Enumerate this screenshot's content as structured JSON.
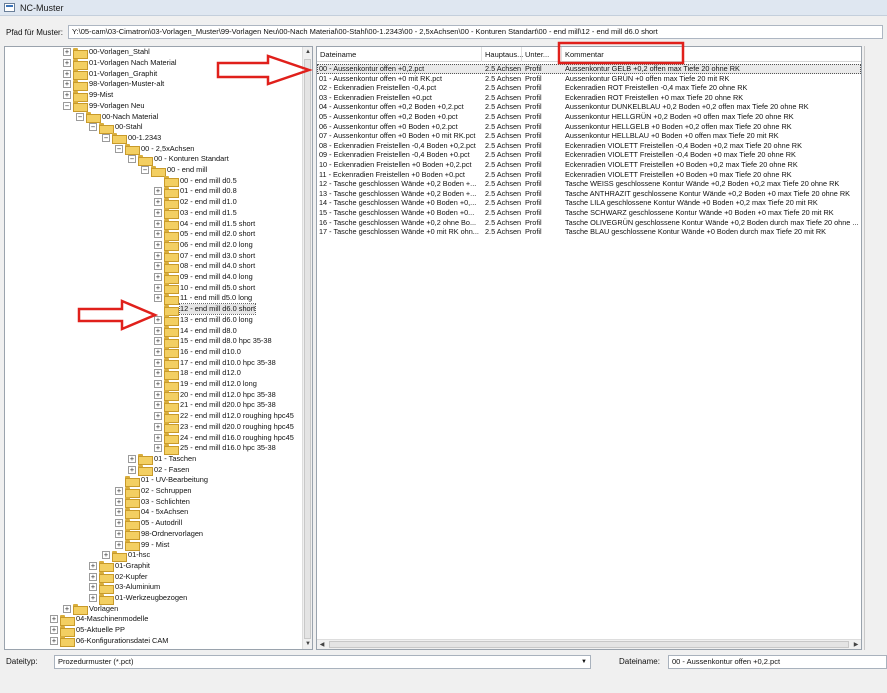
{
  "window": {
    "title": "NC-Muster"
  },
  "path": {
    "label": "Pfad für Muster:",
    "value": "Y:\\05-cam\\03-Cimatron\\03-Vorlagen_Muster\\99-Vorlagen Neu\\00-Nach Material\\00-Stahl\\00-1.2343\\00 - 2,5xAchsen\\00 - Konturen Standart\\00 - end mill\\12 - end mill d6.0 short"
  },
  "tree": {
    "items": [
      {
        "label": "00-Vorlagen_Stahl",
        "expander": "+"
      },
      {
        "label": "01-Vorlagen Nach Material",
        "expander": "+"
      },
      {
        "label": "01-Vorlagen_Graphit",
        "expander": "+"
      },
      {
        "label": "98-Vorlagen-Muster-alt",
        "expander": "+"
      },
      {
        "label": "99-Mist",
        "expander": "+"
      },
      {
        "label": "99-Vorlagen Neu",
        "expander": "−"
      },
      {
        "label": "00-Nach Material",
        "expander": "−"
      },
      {
        "label": "00-Stahl",
        "expander": "−"
      },
      {
        "label": "00-1.2343",
        "expander": "−"
      },
      {
        "label": "00 - 2,5xAchsen",
        "expander": "−"
      },
      {
        "label": "00 - Konturen Standart",
        "expander": "−"
      },
      {
        "label": "00 - end mill",
        "expander": "−"
      },
      {
        "label": "00 - end mill d0.5",
        "expander": ""
      },
      {
        "label": "01 - end mill d0.8",
        "expander": "+"
      },
      {
        "label": "02 - end mill d1.0",
        "expander": "+"
      },
      {
        "label": "03 - end mill d1.5",
        "expander": "+"
      },
      {
        "label": "04 - end mill d1.5 short",
        "expander": "+"
      },
      {
        "label": "05 - end mill d2.0 short",
        "expander": "+"
      },
      {
        "label": "06 - end mill d2.0 long",
        "expander": "+"
      },
      {
        "label": "07 - end mill d3.0 short",
        "expander": "+"
      },
      {
        "label": "08 - end mill d4.0 short",
        "expander": "+"
      },
      {
        "label": "09 - end mill d4.0 long",
        "expander": "+"
      },
      {
        "label": "10 - end mill d5.0 short",
        "expander": "+"
      },
      {
        "label": "11 - end mill d5.0 long",
        "expander": "+"
      },
      {
        "label": "12 - end mill d6.0 short",
        "expander": ""
      },
      {
        "label": "13 - end mill d6.0 long",
        "expander": "+"
      },
      {
        "label": "14 - end mill d8.0",
        "expander": "+"
      },
      {
        "label": "15 - end mill d8.0 hpc 35-38",
        "expander": "+"
      },
      {
        "label": "16 - end mill d10.0",
        "expander": "+"
      },
      {
        "label": "17 - end mill d10.0 hpc 35-38",
        "expander": "+"
      },
      {
        "label": "18 - end mill d12.0",
        "expander": "+"
      },
      {
        "label": "19 - end mill d12.0 long",
        "expander": "+"
      },
      {
        "label": "20 - end mill d12.0 hpc 35-38",
        "expander": "+"
      },
      {
        "label": "21 - end mill d20.0 hpc 35-38",
        "expander": "+"
      },
      {
        "label": "22 - end mill d12.0 roughing hpc45",
        "expander": "+"
      },
      {
        "label": "23 - end mill d20.0 roughing hpc45",
        "expander": "+"
      },
      {
        "label": "24 - end mill d16.0 roughing hpc45",
        "expander": "+"
      },
      {
        "label": "25 - end mill d16.0 hpc 35-38",
        "expander": "+"
      },
      {
        "label": "01 - Taschen",
        "expander": "+"
      },
      {
        "label": "02 - Fasen",
        "expander": "+"
      },
      {
        "label": "01 - UV-Bearbeitung",
        "expander": ""
      },
      {
        "label": "02 - Schruppen",
        "expander": "+"
      },
      {
        "label": "03 - Schlichten",
        "expander": "+"
      },
      {
        "label": "04 - 5xAchsen",
        "expander": "+"
      },
      {
        "label": "05 - Autodrill",
        "expander": "+"
      },
      {
        "label": "98-Ordnervorlagen",
        "expander": "+"
      },
      {
        "label": "99 - Mist",
        "expander": "+"
      },
      {
        "label": "01-hsc",
        "expander": "+"
      },
      {
        "label": "01-Graphit",
        "expander": "+"
      },
      {
        "label": "02-Kupfer",
        "expander": "+"
      },
      {
        "label": "03-Aluminium",
        "expander": "+"
      },
      {
        "label": "01-Werkzeugbezogen",
        "expander": "+"
      },
      {
        "label": "Vorlagen",
        "expander": "+"
      },
      {
        "label": "04-Maschinenmodelle",
        "expander": "+"
      },
      {
        "label": "05-Aktuelle PP",
        "expander": "+"
      },
      {
        "label": "06-Konfigurationsdatei CAM",
        "expander": "+"
      }
    ]
  },
  "files": {
    "columns": [
      "Dateiname",
      "Hauptaus...",
      "Unter...",
      "Kommentar"
    ],
    "rows": [
      [
        "00 - Aussenkontur offen +0,2.pct",
        "2.5 Achsen",
        "Profil",
        "Aussenkontur GELB +0,2 offen max Tiefe 20 ohne RK"
      ],
      [
        "01 - Aussenkontur offen +0 mit RK.pct",
        "2.5 Achsen",
        "Profil",
        "Aussenkontur GRÜN +0 offen max Tiefe 20 mit RK"
      ],
      [
        "02 - Eckenradien Freistellen -0,4.pct",
        "2.5 Achsen",
        "Profil",
        "Eckenradien ROT Freistellen -0,4 max Tiefe 20 ohne RK"
      ],
      [
        "03 - Eckenradien Freistellen +0.pct",
        "2.5 Achsen",
        "Profil",
        "Eckenradien ROT Freistellen +0 max Tiefe 20 ohne RK"
      ],
      [
        "04 - Aussenkontur offen +0,2 Boden +0,2.pct",
        "2.5 Achsen",
        "Profil",
        "Aussenkontur DUNKELBLAU +0,2 Boden +0,2 offen max Tiefe 20 ohne RK"
      ],
      [
        "05 - Aussenkontur offen +0,2 Boden +0.pct",
        "2.5 Achsen",
        "Profil",
        "Aussenkontur HELLGRÜN +0,2 Boden +0 offen max Tiefe 20 ohne RK"
      ],
      [
        "06 - Aussenkontur offen +0 Boden +0,2.pct",
        "2.5 Achsen",
        "Profil",
        "Aussenkontur HELLGELB +0 Boden +0,2 offen max Tiefe 20 ohne RK"
      ],
      [
        "07 - Aussenkontur offen +0 Boden +0 mit RK.pct",
        "2.5 Achsen",
        "Profil",
        "Aussenkontur HELLBLAU +0 Boden +0 offen max Tiefe 20 mit RK"
      ],
      [
        "08 - Eckenradien Freistellen -0,4 Boden +0,2.pct",
        "2.5 Achsen",
        "Profil",
        "Eckenradien VIOLETT Freistellen -0,4 Boden +0,2 max Tiefe 20 ohne RK"
      ],
      [
        "09 - Eckenradien Freistellen -0,4 Boden +0.pct",
        "2.5 Achsen",
        "Profil",
        "Eckenradien VIOLETT Freistellen -0,4 Boden +0 max Tiefe 20 ohne RK"
      ],
      [
        "10 - Eckenradien Freistellen +0 Boden +0,2.pct",
        "2.5 Achsen",
        "Profil",
        "Eckenradien VIOLETT Freistellen +0 Boden +0,2 max Tiefe 20 ohne RK"
      ],
      [
        "11 - Eckenradien Freistellen +0 Boden +0.pct",
        "2.5 Achsen",
        "Profil",
        "Eckenradien VIOLETT Freistellen +0 Boden +0 max Tiefe 20 ohne RK"
      ],
      [
        "12 - Tasche geschlossen Wände +0,2 Boden +...",
        "2.5 Achsen",
        "Profil",
        "Tasche WEISS geschlossene Kontur Wände +0,2 Boden +0,2 max Tiefe 20 ohne RK"
      ],
      [
        "13 - Tasche geschlossen Wände +0,2 Boden +...",
        "2.5 Achsen",
        "Profil",
        "Tasche ANTHRAZIT geschlossene Kontur Wände +0,2 Boden +0 max Tiefe 20 ohne RK"
      ],
      [
        "14 - Tasche geschlossen Wände +0 Boden +0,...",
        "2.5 Achsen",
        "Profil",
        "Tasche LILA geschlossene Kontur Wände +0 Boden +0,2 max Tiefe 20 mit RK"
      ],
      [
        "15 - Tasche geschlossen Wände +0 Boden +0...",
        "2.5 Achsen",
        "Profil",
        "Tasche SCHWARZ geschlossene Kontur Wände +0 Boden +0 max Tiefe 20 mit RK"
      ],
      [
        "16 - Tasche geschlossen Wände +0,2 ohne Bo...",
        "2.5 Achsen",
        "Profil",
        "Tasche OLIVEGRÜN geschlossene Kontur Wände +0,2 Boden durch max Tiefe 20 ohne ..."
      ],
      [
        "17 - Tasche geschlossen Wände +0 mit RK ohn...",
        "2.5 Achsen",
        "Profil",
        "Tasche BLAU geschlossene Kontur Wände +0 Boden durch max Tiefe 20 mit RK"
      ]
    ]
  },
  "bottom": {
    "filetype_label": "Dateityp:",
    "filetype_value": "Prozedurmuster (*.pct)",
    "filename_label": "Dateiname:",
    "filename_value": "00 - Aussenkontur offen +0,2.pct"
  },
  "colors": {
    "annotation": "#e0201b",
    "selection": "#eaeaea",
    "folder": "#f3cf62"
  },
  "icons": [
    "folder-icon",
    "expand-icon",
    "collapse-icon",
    "arrow-up-icon",
    "arrow-down-icon",
    "arrow-left-icon",
    "arrow-right-icon",
    "dropdown-icon"
  ]
}
